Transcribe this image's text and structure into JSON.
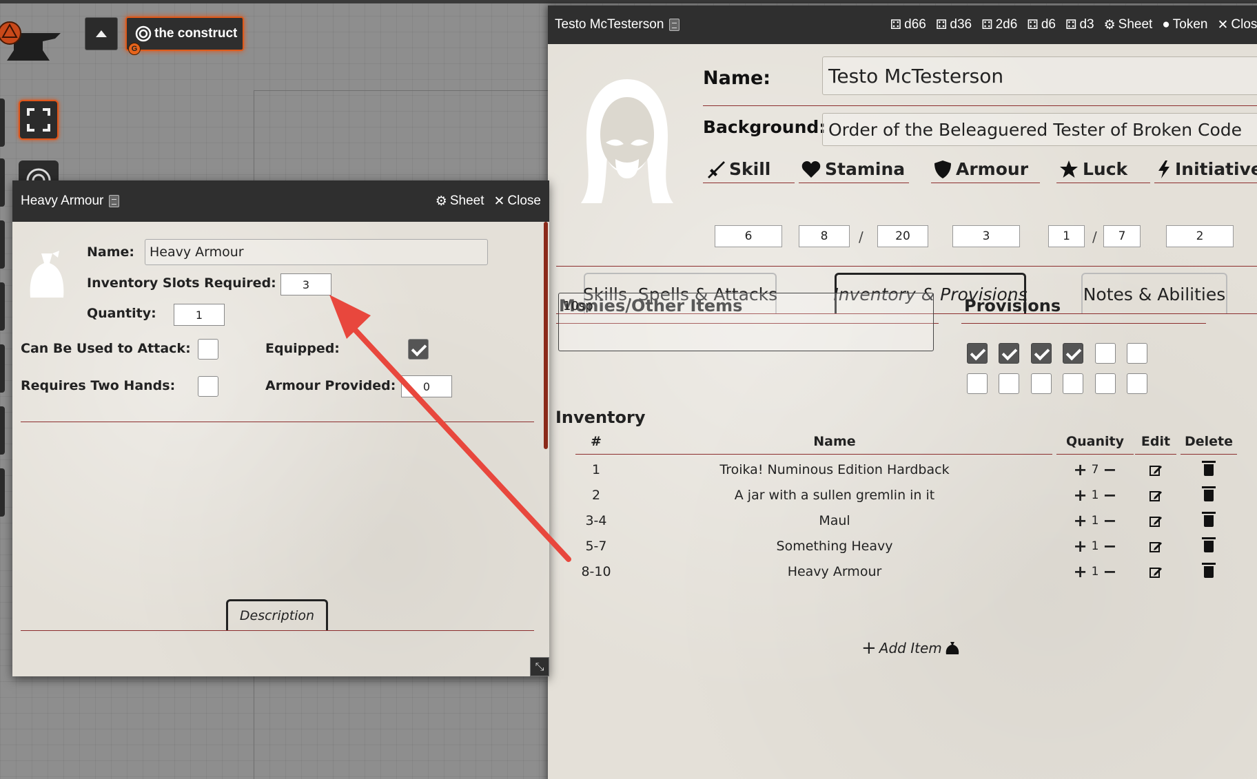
{
  "toolbar": {
    "layer_label": "the construct",
    "layer_badge": "G"
  },
  "character_sheet": {
    "window_title": "Testo McTesterson",
    "controls": {
      "d66": "d66",
      "d36": "d36",
      "2d6": "2d6",
      "d6": "d6",
      "d3": "d3",
      "sheet": "Sheet",
      "token": "Token",
      "close": "Close"
    },
    "name_label": "Name:",
    "name_value": "Testo McTesterson",
    "background_label": "Background:",
    "background_value": "Order of the Beleaguered Tester of Broken Code",
    "stats": {
      "skill": {
        "label": "Skill",
        "value": "6"
      },
      "stamina": {
        "label": "Stamina",
        "current": "8",
        "separator": "/",
        "max": "20"
      },
      "armour": {
        "label": "Armour",
        "value": "3"
      },
      "luck": {
        "label": "Luck",
        "current": "1",
        "separator": "/",
        "max": "7"
      },
      "initiative": {
        "label": "Initiative",
        "value": "2"
      }
    },
    "tabs": {
      "skills": "Skills, Spells & Attacks",
      "inventory": "Inventory & Provisions",
      "notes": "Notes & Abilities"
    },
    "monies_heading": "Monies/Other Items",
    "monies_value": "10sp",
    "provisions_heading": "Provisions",
    "provisions": [
      true,
      true,
      true,
      true,
      false,
      false,
      false,
      false,
      false,
      false,
      false,
      false
    ],
    "inventory_heading": "Inventory",
    "columns": {
      "num": "#",
      "name": "Name",
      "quantity": "Quanity",
      "edit": "Edit",
      "delete": "Delete"
    },
    "inventory": [
      {
        "num": "1",
        "name": "Troika! Numinous Edition Hardback",
        "qty": "7"
      },
      {
        "num": "2",
        "name": "A jar with a sullen gremlin in it",
        "qty": "1"
      },
      {
        "num": "3-4",
        "name": "Maul",
        "qty": "1"
      },
      {
        "num": "5-7",
        "name": "Something Heavy",
        "qty": "1"
      },
      {
        "num": "8-10",
        "name": "Heavy Armour",
        "qty": "1"
      }
    ],
    "add_item": "Add Item"
  },
  "item_sheet": {
    "window_title": "Heavy Armour",
    "controls": {
      "sheet": "Sheet",
      "close": "Close"
    },
    "name_label": "Name:",
    "name_value": "Heavy Armour",
    "slots_label": "Inventory Slots Required:",
    "slots_value": "3",
    "quantity_label": "Quantity:",
    "quantity_value": "1",
    "attack_label": "Can Be Used to Attack:",
    "attack_checked": false,
    "equipped_label": "Equipped:",
    "equipped_checked": true,
    "two_hands_label": "Requires Two Hands:",
    "two_hands_checked": false,
    "armour_label": "Armour Provided:",
    "armour_value": "0",
    "description_tab": "Description"
  },
  "colors": {
    "accent_orange": "#e0561a",
    "rule_red": "#8b2c2c",
    "annotation_arrow": "#e8473d",
    "titlebar": "#2f2f2f",
    "parchment": "#e4e0d8"
  }
}
